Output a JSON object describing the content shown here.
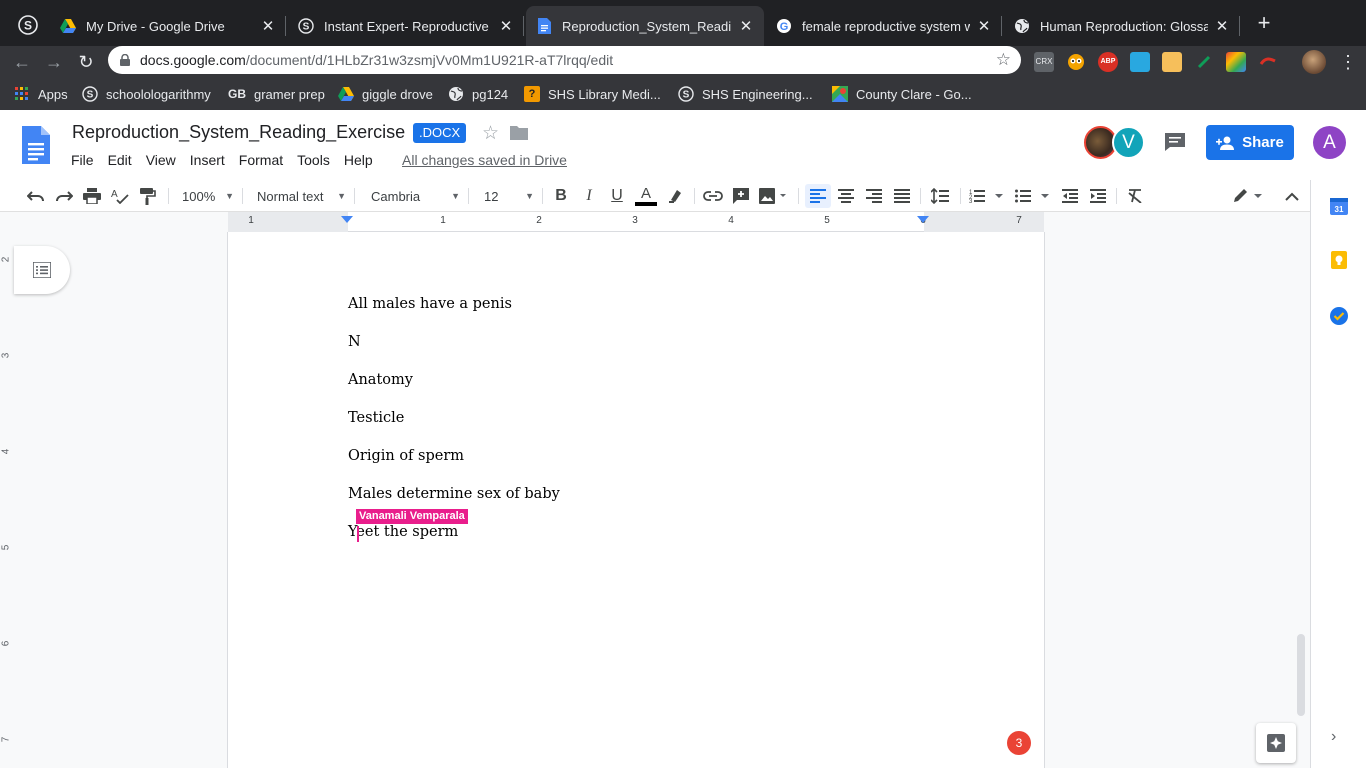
{
  "browser": {
    "pinned_tab_icon": "schoology-icon",
    "tabs": [
      {
        "title": "My Drive - Google Drive",
        "icon": "google-drive-icon"
      },
      {
        "title": "Instant Expert- Reproductive S",
        "icon": "schoology-icon"
      },
      {
        "title": "Reproduction_System_Reading",
        "icon": "google-docs-icon",
        "active": true
      },
      {
        "title": "female reproductive system wo",
        "icon": "google-icon"
      },
      {
        "title": "Human Reproduction: Glossary",
        "icon": "globe-icon"
      }
    ],
    "new_tab_label": "+",
    "url_host": "docs.google.com",
    "url_path": "/document/d/1HLbZr31w3zsmjVv0Mm1U921R-aT7lrqq/edit",
    "bookmarks": [
      {
        "label": "Apps",
        "icon": "apps-grid-icon"
      },
      {
        "label": "schoolologarithmy",
        "icon": "schoology-icon"
      },
      {
        "label": "gramer prep",
        "icon": "gb-icon"
      },
      {
        "label": "giggle drove",
        "icon": "google-drive-icon"
      },
      {
        "label": "pg124",
        "icon": "globe-icon"
      },
      {
        "label": "SHS Library Medi...",
        "icon": "library-icon"
      },
      {
        "label": "SHS Engineering...",
        "icon": "schoology-icon"
      },
      {
        "label": "County Clare - Go...",
        "icon": "maps-icon"
      }
    ]
  },
  "docs": {
    "title": "Reproduction_System_Reading_Exercise",
    "badge": ".DOCX",
    "menu": [
      "File",
      "Edit",
      "View",
      "Insert",
      "Format",
      "Tools",
      "Help"
    ],
    "save_status": "All changes saved in Drive",
    "collaborator_initial": "V",
    "share_label": "Share",
    "account_initial": "A"
  },
  "toolbar": {
    "zoom": "100%",
    "style": "Normal text",
    "font": "Cambria",
    "font_size": "12"
  },
  "ruler": {
    "numbers": [
      "1",
      "1",
      "2",
      "3",
      "4",
      "5",
      "6",
      "7"
    ]
  },
  "vruler": {
    "numbers": [
      "2",
      "3",
      "4",
      "5",
      "6",
      "7"
    ]
  },
  "document": {
    "paragraphs": [
      "All males have a penis",
      "N",
      "Anatomy",
      "Testicle",
      "Origin of sperm",
      "Males determine sex of baby",
      "Yeet the sperm"
    ],
    "collaborator_cursor_name": "Vanamali Vemparala"
  },
  "notifications": {
    "count": "3"
  },
  "colors": {
    "accent": "#1a73e8",
    "collaborator_cursor": "#e91e8c",
    "notification": "#ea4335",
    "account_avatar": "#8e44c5",
    "collaborator_avatar": "#12a4b9"
  }
}
